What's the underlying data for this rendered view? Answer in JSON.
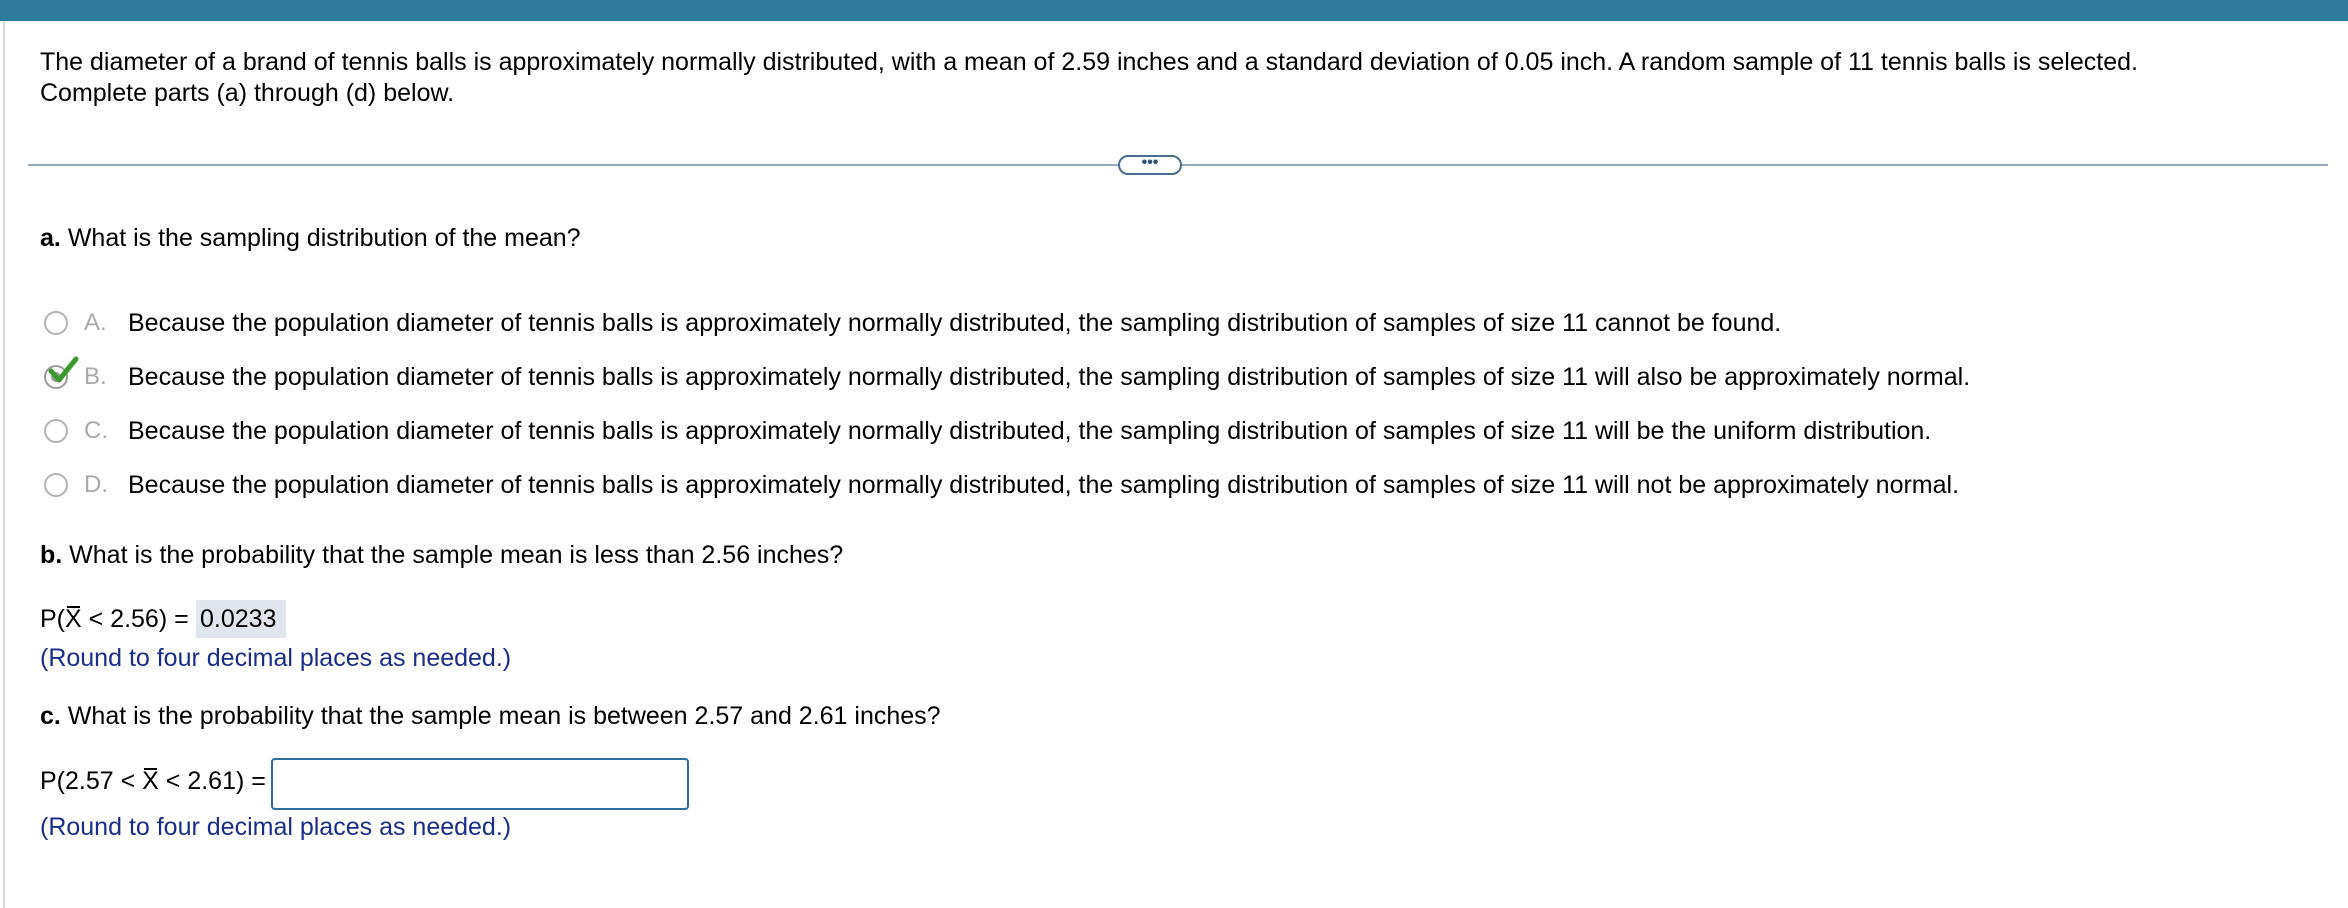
{
  "problem": {
    "line1": "The diameter of a brand of tennis balls is approximately normally distributed, with a mean of 2.59 inches and a standard deviation of 0.05 inch. A random sample of 11 tennis balls is selected.",
    "line2": "Complete parts (a) through (d) below."
  },
  "divider": {
    "ellipsis": "•••"
  },
  "part_a": {
    "label": "a.",
    "question": "What is the sampling distribution of the mean?",
    "options": [
      {
        "letter": "A.",
        "text": "Because the population diameter of tennis balls is approximately normally distributed, the sampling distribution of samples of size 11 cannot be found.",
        "selected": false
      },
      {
        "letter": "B.",
        "text": "Because the population diameter of tennis balls is approximately normally distributed, the sampling distribution of samples of size 11 will also be approximately normal.",
        "selected": true,
        "correct": true
      },
      {
        "letter": "C.",
        "text": "Because the population diameter of tennis balls is approximately normally distributed, the sampling distribution of samples of size 11 will be the uniform distribution.",
        "selected": false
      },
      {
        "letter": "D.",
        "text": "Because the population diameter of tennis balls is approximately normally distributed, the sampling distribution of samples of size 11 will not be approximately normal.",
        "selected": false
      }
    ]
  },
  "part_b": {
    "label": "b.",
    "question": "What is the probability that the sample mean is less than 2.56 inches?",
    "expr_prefix": "P(",
    "expr_var": "X",
    "expr_suffix": " < 2.56) =",
    "answer": "0.0233",
    "hint": "(Round to four decimal places as needed.)"
  },
  "part_c": {
    "label": "c.",
    "question": "What is the probability that the sample mean is between 2.57 and 2.61 inches?",
    "expr_prefix": "P(2.57 < ",
    "expr_var": "X",
    "expr_suffix": " < 2.61) =",
    "answer_value": "",
    "hint": "(Round to four decimal places as needed.)"
  },
  "colors": {
    "top_bar": "#317a9c",
    "hint_text": "#1a2d8a",
    "check_green": "#3a9a2e",
    "answer_bg": "#e1e6ee",
    "input_border": "#2c6e9c"
  }
}
